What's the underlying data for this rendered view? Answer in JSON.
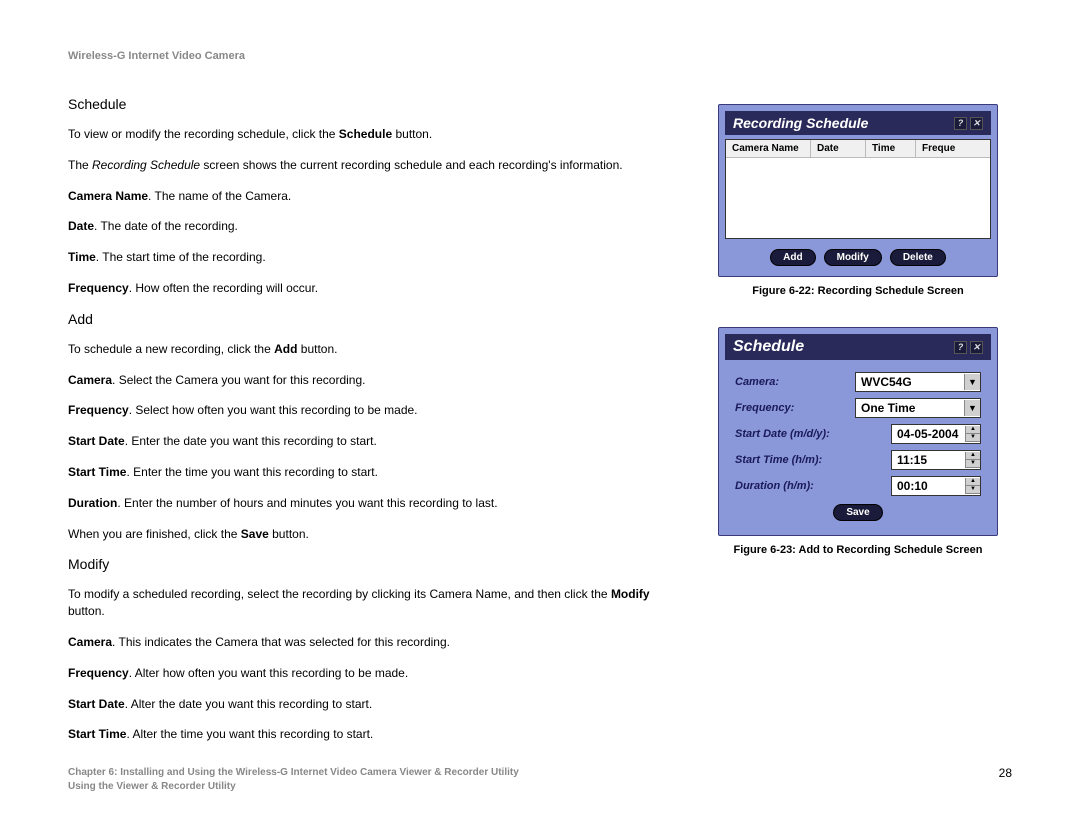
{
  "header": "Wireless-G Internet Video Camera",
  "sections": {
    "schedule": {
      "heading": "Schedule",
      "p1_a": "To view or modify the recording schedule, click the ",
      "p1_b": "Schedule",
      "p1_c": " button.",
      "p2_a": "The ",
      "p2_b": "Recording Schedule",
      "p2_c": " screen shows the current recording schedule and each recording's information.",
      "fields": {
        "camera_name_label": "Camera Name",
        "camera_name_desc": ". The name of the Camera.",
        "date_label": "Date",
        "date_desc": ". The date of the recording.",
        "time_label": "Time",
        "time_desc": ". The start time of the recording.",
        "freq_label": "Frequency",
        "freq_desc": ". How often the recording will occur."
      }
    },
    "add": {
      "heading": "Add",
      "p1_a": "To schedule a new recording, click the ",
      "p1_b": "Add",
      "p1_c": " button.",
      "fields": {
        "camera_label": "Camera",
        "camera_desc": ". Select the Camera you want for this recording.",
        "freq_label": "Frequency",
        "freq_desc": ". Select how often you want this recording to be made.",
        "sdate_label": "Start Date",
        "sdate_desc": ". Enter the date you want this recording to start.",
        "stime_label": "Start Time",
        "stime_desc": ". Enter the time you want this recording to start.",
        "dur_label": "Duration",
        "dur_desc": ". Enter the number of hours and minutes you want this recording to last."
      },
      "p2_a": "When you are finished, click the ",
      "p2_b": "Save",
      "p2_c": " button."
    },
    "modify": {
      "heading": "Modify",
      "p1_a": "To modify a scheduled recording, select the recording by clicking its Camera Name, and then click the ",
      "p1_b": "Modify",
      "p1_c": " button.",
      "fields": {
        "camera_label": "Camera",
        "camera_desc": ". This indicates the Camera that was selected for this recording.",
        "freq_label": "Frequency",
        "freq_desc": ". Alter how often you want this recording to be made.",
        "sdate_label": "Start Date",
        "sdate_desc": ". Alter the date you want this recording to start.",
        "stime_label": "Start Time",
        "stime_desc": ". Alter the time you want this recording to start."
      }
    }
  },
  "fig1": {
    "title": "Recording Schedule",
    "cols": {
      "c1": "Camera Name",
      "c2": "Date",
      "c3": "Time",
      "c4": "Freque"
    },
    "buttons": {
      "add": "Add",
      "modify": "Modify",
      "delete": "Delete"
    },
    "caption": "Figure 6-22: Recording Schedule Screen"
  },
  "fig2": {
    "title": "Schedule",
    "rows": {
      "camera": {
        "label": "Camera:",
        "value": "WVC54G"
      },
      "freq": {
        "label": "Frequency:",
        "value": "One Time"
      },
      "sdate": {
        "label": "Start Date (m/d/y):",
        "value": "04-05-2004"
      },
      "stime": {
        "label": "Start Time (h/m):",
        "value": "11:15"
      },
      "dur": {
        "label": "Duration (h/m):",
        "value": "00:10"
      }
    },
    "save": "Save",
    "caption": "Figure 6-23: Add to Recording Schedule Screen"
  },
  "footer": {
    "chapter": "Chapter 6: Installing and Using the Wireless-G Internet Video Camera Viewer & Recorder Utility",
    "section": "Using the Viewer & Recorder Utility",
    "page": "28"
  }
}
